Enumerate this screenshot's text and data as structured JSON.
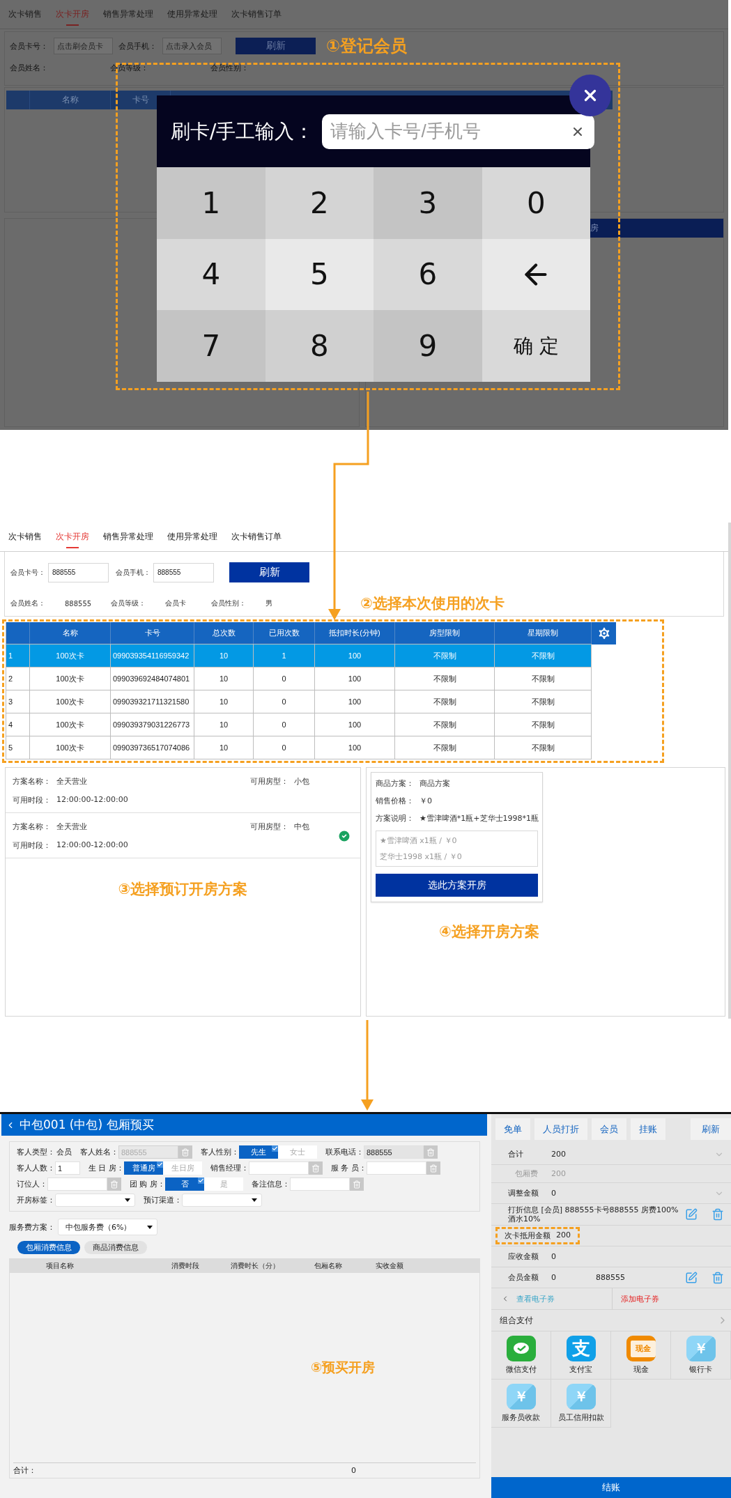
{
  "step1": {
    "annotation": "①登记会员",
    "screen": {
      "tabs": [
        {
          "label": "次卡销售",
          "selected": false
        },
        {
          "label": "次卡开房",
          "selected": true
        },
        {
          "label": "销售异常处理",
          "selected": false
        },
        {
          "label": "使用异常处理",
          "selected": false
        },
        {
          "label": "次卡销售订单",
          "selected": false
        }
      ],
      "card_label": "会员卡号：",
      "card_placeholder": "点击刷会员卡",
      "phone_label": "会员手机：",
      "phone_placeholder": "点击录入会员",
      "refresh": "刷新",
      "info_labels": [
        "会员姓名：",
        "会员等级：",
        "会员性别："
      ],
      "columns": [
        "名称",
        "卡号"
      ],
      "open_button": "房"
    },
    "dialog": {
      "label": "刷卡/手工输入：",
      "placeholder": "请输入卡号/手机号",
      "keys": [
        {
          "kind": "digit",
          "label": "1"
        },
        {
          "kind": "digit",
          "label": "2"
        },
        {
          "kind": "digit",
          "label": "3"
        },
        {
          "kind": "digit",
          "label": "0"
        },
        {
          "kind": "digit",
          "label": "4"
        },
        {
          "kind": "digit",
          "label": "5"
        },
        {
          "kind": "digit",
          "label": "6"
        },
        {
          "kind": "backspace"
        },
        {
          "kind": "digit",
          "label": "7"
        },
        {
          "kind": "digit",
          "label": "8"
        },
        {
          "kind": "digit",
          "label": "9"
        },
        {
          "kind": "confirm",
          "label": "确 定"
        }
      ]
    }
  },
  "step2": {
    "tabs": [
      {
        "label": "次卡销售",
        "selected": false
      },
      {
        "label": "次卡开房",
        "selected": true
      },
      {
        "label": "销售异常处理",
        "selected": false
      },
      {
        "label": "使用异常处理",
        "selected": false
      },
      {
        "label": "次卡销售订单",
        "selected": false
      }
    ],
    "member": {
      "fields": [
        {
          "label": "会员卡号：",
          "value": "888555"
        },
        {
          "label": "会员手机：",
          "value": "888555"
        }
      ],
      "refresh": "刷新",
      "info": [
        {
          "label": "会员姓名：",
          "value": "888555"
        },
        {
          "label": "会员等级：",
          "value": "会员卡"
        },
        {
          "label": "会员性别：",
          "value": "男"
        }
      ]
    },
    "annotation": "②选择本次使用的次卡",
    "table": {
      "columns": [
        "",
        "名称",
        "卡号",
        "总次数",
        "已用次数",
        "抵扣时长(分钟)",
        "房型限制",
        "星期限制"
      ],
      "rows": [
        {
          "cells": [
            "1",
            "100次卡",
            "099039354116959342",
            "10",
            "1",
            "100",
            "不限制",
            "不限制"
          ],
          "selected": true
        },
        {
          "cells": [
            "2",
            "100次卡",
            "099039692484074801",
            "10",
            "0",
            "100",
            "不限制",
            "不限制"
          ],
          "selected": false
        },
        {
          "cells": [
            "3",
            "100次卡",
            "099039321711321580",
            "10",
            "0",
            "100",
            "不限制",
            "不限制"
          ],
          "selected": false
        },
        {
          "cells": [
            "4",
            "100次卡",
            "099039379031226773",
            "10",
            "0",
            "100",
            "不限制",
            "不限制"
          ],
          "selected": false
        },
        {
          "cells": [
            "5",
            "100次卡",
            "099039736517074086",
            "10",
            "0",
            "100",
            "不限制",
            "不限制"
          ],
          "selected": false
        }
      ]
    },
    "plans": [
      {
        "fields": [
          {
            "label": "方案名称：",
            "value": "全天营业"
          },
          {
            "label": "可用房型：",
            "value": "小包"
          },
          {
            "label": "可用时段：",
            "value": "12:00:00-12:00:00"
          }
        ],
        "selected": false
      },
      {
        "fields": [
          {
            "label": "方案名称：",
            "value": "全天营业"
          },
          {
            "label": "可用房型：",
            "value": "中包"
          },
          {
            "label": "可用时段：",
            "value": "12:00:00-12:00:00"
          }
        ],
        "selected": true
      }
    ],
    "plans_annotation": "③选择预订开房方案",
    "product": {
      "lines": [
        {
          "label": "商品方案：",
          "value": "商品方案"
        },
        {
          "label": "销售价格：",
          "value": "￥0"
        },
        {
          "label": "方案说明：",
          "value": "★雪津啤酒*1瓶+芝华士1998*1瓶"
        }
      ],
      "items": [
        "★雪津啤酒 x1瓶 / ￥0",
        "芝华士1998 x1瓶 / ￥0"
      ],
      "button": "选此方案开房"
    },
    "product_annotation": "④选择开房方案"
  },
  "step3": {
    "title": "中包001 (中包) 包厢预买",
    "form_rows": [
      [
        {
          "kind": "static",
          "label": "客人类型：",
          "value": "会员"
        },
        {
          "kind": "input",
          "label": "客人姓名：",
          "value": "888555",
          "disabled": true,
          "readonly": true,
          "clearable": true
        },
        {
          "kind": "toggle",
          "label": "客人性别：",
          "options": [
            {
              "label": "先生",
              "selected": true
            },
            {
              "label": "女士",
              "selected": false
            }
          ]
        },
        {
          "kind": "input",
          "label": "联系电话：",
          "value": "888555",
          "disabled": false,
          "readonly": true,
          "clearable": true
        }
      ],
      [
        {
          "kind": "input",
          "label": "客人人数：",
          "value": "1",
          "disabled": false,
          "readonly": false,
          "clearable": false
        },
        {
          "kind": "toggle",
          "label": "生 日 房：",
          "options": [
            {
              "label": "普通房",
              "selected": true
            },
            {
              "label": "生日房",
              "selected": false
            }
          ]
        },
        {
          "kind": "input",
          "label": "销售经理：",
          "disabled": false,
          "readonly": false,
          "clearable": true
        },
        {
          "kind": "input",
          "label": "服 务 员：",
          "disabled": false,
          "readonly": false,
          "clearable": true
        }
      ],
      [
        {
          "kind": "input",
          "label": "订位人：",
          "disabled": false,
          "readonly": false,
          "clearable": true
        },
        {
          "kind": "toggle",
          "label": "团 购 房：",
          "options": [
            {
              "label": "否",
              "selected": true
            },
            {
              "label": "是",
              "selected": false
            }
          ]
        },
        {
          "kind": "input",
          "label": "备注信息：",
          "disabled": false,
          "readonly": false,
          "clearable": true
        }
      ],
      [
        {
          "kind": "select",
          "label": "开房标签："
        },
        {
          "kind": "select",
          "label": "预订渠道："
        }
      ]
    ],
    "service": {
      "label": "服务费方案：",
      "value": "中包服务费（6%）"
    },
    "tabs": [
      {
        "label": "包厢消费信息",
        "selected": true
      },
      {
        "label": "商品消费信息",
        "selected": false
      }
    ],
    "columns": [
      "项目名称",
      "消费时段",
      "消费时长（分）",
      "包厢名称",
      "实收金额"
    ],
    "total_label": "合计：",
    "total": "0",
    "annotation": "⑤预买开房",
    "actions": [
      "免单",
      "人员打折",
      "会员",
      "挂账",
      "刷新"
    ],
    "summary": [
      {
        "kind": "expand",
        "label": "合计",
        "value": "200"
      },
      {
        "kind": "sub",
        "label": "包厢费",
        "value": "200"
      },
      {
        "kind": "expand",
        "label": "调整金额",
        "value": "0"
      },
      {
        "kind": "editable",
        "label": "打折信息",
        "value": "[会员] 888555卡号888555 房费100%酒水10%"
      },
      {
        "kind": "highlight",
        "label": "次卡抵用金额",
        "value": "200"
      },
      {
        "kind": "plain",
        "label": "应收金额",
        "value": "0"
      },
      {
        "kind": "editable",
        "label": "会员金额",
        "value": "0",
        "extra": "888555"
      }
    ],
    "coupons": {
      "view": "查看电子券",
      "add": "添加电子券"
    },
    "combo": "组合支付",
    "payments": [
      {
        "kind": "wechat",
        "label": "微信支付"
      },
      {
        "kind": "alipay",
        "label": "支付宝",
        "symbol": "支"
      },
      {
        "kind": "cash",
        "label": "现金",
        "icon_text": "现金"
      },
      {
        "kind": "yen",
        "label": "银行卡",
        "symbol": "￥"
      },
      {
        "kind": "yen",
        "label": "服务员收款",
        "symbol": "￥"
      },
      {
        "kind": "yen",
        "label": "员工信用扣款",
        "symbol": "￥"
      }
    ],
    "checkout": "结账"
  }
}
